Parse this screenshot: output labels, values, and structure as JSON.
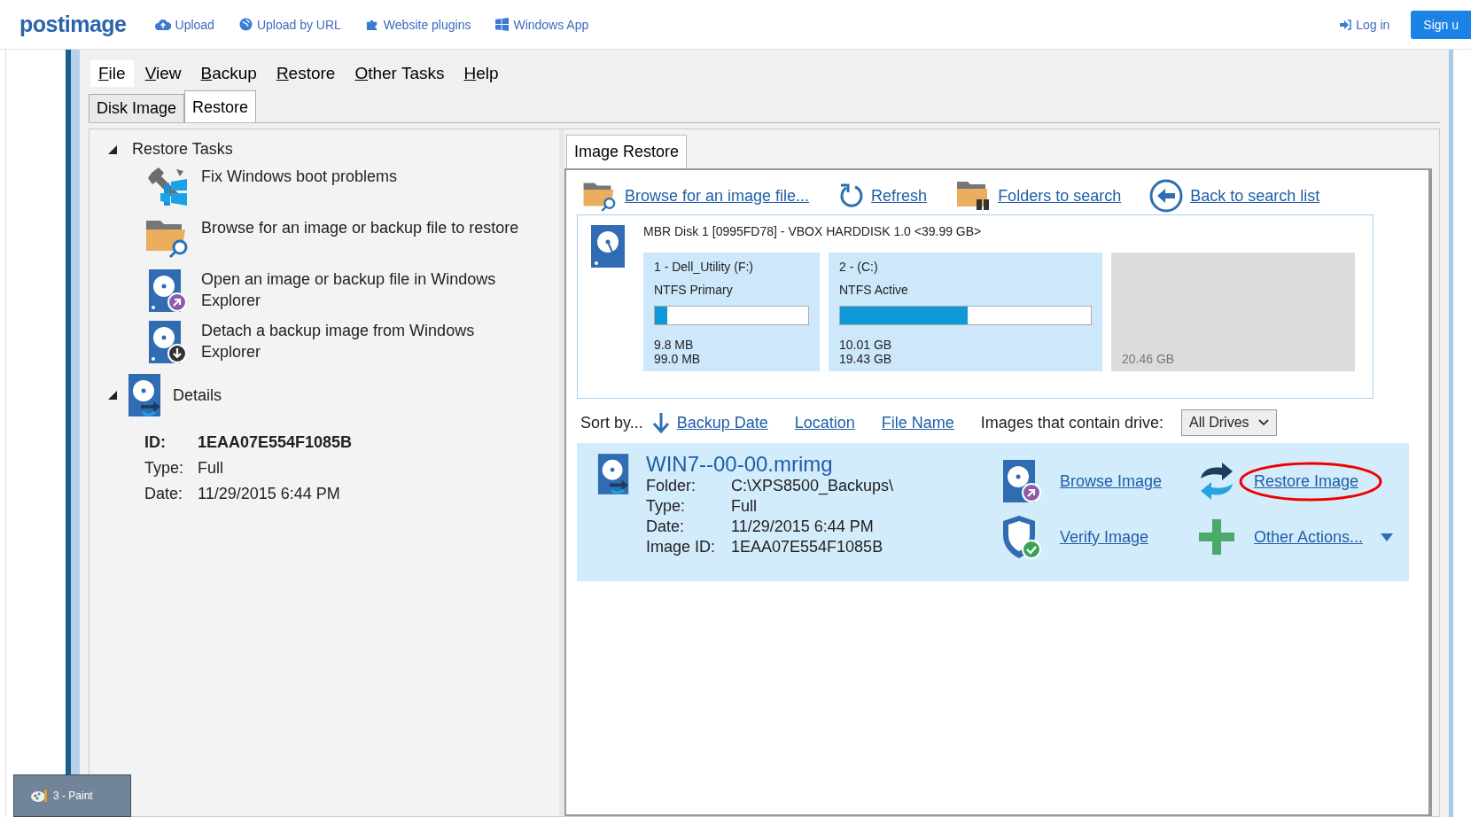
{
  "site_header": {
    "logo": "postimage",
    "nav": [
      "Upload",
      "Upload by URL",
      "Website plugins",
      "Windows App"
    ],
    "login": "Log in",
    "signup": "Sign u"
  },
  "menu": [
    {
      "label": "File",
      "selected": true
    },
    {
      "label": "View",
      "selected": false
    },
    {
      "label": "Backup",
      "selected": false
    },
    {
      "label": "Restore",
      "selected": false
    },
    {
      "label": "Other Tasks",
      "selected": false
    },
    {
      "label": "Help",
      "selected": false
    }
  ],
  "tabs": [
    {
      "label": "Disk Image",
      "selected": false
    },
    {
      "label": "Restore",
      "selected": true
    }
  ],
  "tasks_section": {
    "title": "Restore Tasks",
    "expanded": true,
    "tasks": [
      "Fix Windows boot problems",
      "Browse for an image or backup file to restore",
      "Open an image or backup file in Windows Explorer",
      "Detach a backup image from Windows Explorer"
    ]
  },
  "details_section": {
    "title": "Details",
    "expanded": true,
    "fields": [
      {
        "label": "ID:",
        "value": "1EAA07E554F1085B",
        "emphasis": true
      },
      {
        "label": "Type:",
        "value": "Full",
        "emphasis": false
      },
      {
        "label": "Date:",
        "value": "11/29/2015 6:44 PM",
        "emphasis": false
      }
    ]
  },
  "inner_tabs": [
    {
      "label": "Image Restore",
      "selected": true
    }
  ],
  "toolbar": [
    "Browse for an image file...",
    "Refresh",
    "Folders to search",
    "Back to search list"
  ],
  "disk": {
    "title": "MBR Disk 1 [0995FD78] - VBOX HARDDISK 1.0  <39.99 GB>",
    "partitions": [
      {
        "kind": "partition",
        "name": "1 - Dell_Utility (F:)",
        "fs": "NTFS Primary",
        "level": 0.08,
        "used": "9.8 MB",
        "size": "99.0 MB"
      },
      {
        "kind": "partition",
        "name": "2 -  (C:)",
        "fs": "NTFS Active",
        "level": 0.51,
        "used": "10.01 GB",
        "size": "19.43 GB"
      },
      {
        "kind": "unallocated",
        "size": "20.46 GB"
      }
    ]
  },
  "sort": {
    "label": "Sort by...",
    "options": [
      {
        "label": "Backup Date",
        "selected": true
      },
      {
        "label": "Location",
        "selected": false
      },
      {
        "label": "File Name",
        "selected": false
      }
    ],
    "filter_label": "Images that contain drive:",
    "filter_value": "All Drives"
  },
  "image": {
    "name": "WIN7--00-00.mrimg",
    "fields": [
      {
        "label": "Folder:",
        "value": "C:\\XPS8500_Backups\\"
      },
      {
        "label": "Type:",
        "value": "Full"
      },
      {
        "label": "Date:",
        "value": "11/29/2015 6:44 PM"
      },
      {
        "label": "Image ID:",
        "value": "1EAA07E554F1085B"
      }
    ],
    "actions": [
      {
        "label": "Browse Image",
        "circled": false,
        "dropdown": false
      },
      {
        "label": "Restore Image",
        "circled": true,
        "dropdown": false
      },
      {
        "label": "Verify Image",
        "circled": false,
        "dropdown": false
      },
      {
        "label": "Other Actions...",
        "circled": false,
        "dropdown": true
      }
    ]
  },
  "taskbar_tooltip": "3 - Paint"
}
